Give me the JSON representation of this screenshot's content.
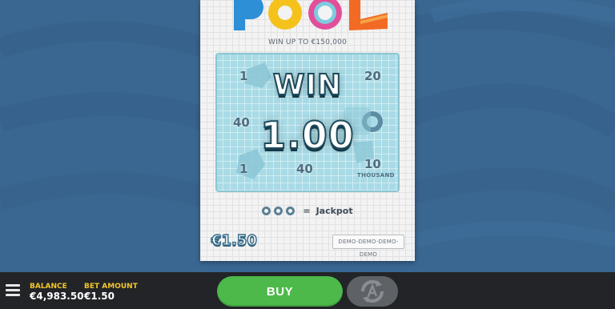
{
  "game": {
    "logo_text": "POOL",
    "win_up_to": "WIN UP TO €150,000"
  },
  "play_area": {
    "symbols": [
      {
        "text": "1"
      },
      {
        "text": "20"
      },
      {
        "text": "40"
      },
      {
        "text": "1"
      },
      {
        "text": "40"
      },
      {
        "text": "10",
        "sub": "THOUSAND"
      }
    ],
    "win_label": "WIN",
    "win_amount": "1.00"
  },
  "jackpot": {
    "label": "Jackpot",
    "equals": "="
  },
  "ticket_price": "€1.50",
  "demo_badge": "DEMO-DEMO-DEMO-DEMO",
  "bottom_bar": {
    "balance_label": "BALANCE",
    "balance_value": "€4,983.50",
    "bet_label": "BET AMOUNT",
    "bet_value": "€1.50",
    "buy_label": "BUY",
    "icons": {
      "menu": "hamburger-menu-icon",
      "autoplay": "autoplay-icon"
    }
  },
  "colors": {
    "background": "#3a6792",
    "buy_button": "#4cb94a",
    "label_yellow": "#f2c62c",
    "bottom_bar": "#222427"
  }
}
